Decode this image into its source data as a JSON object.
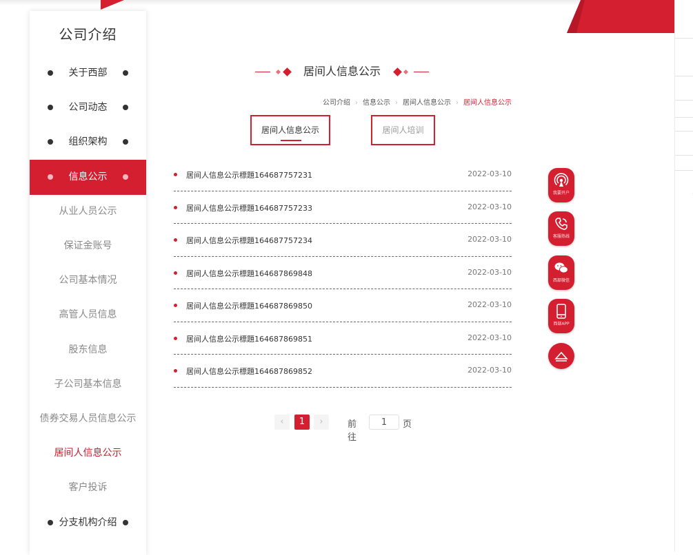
{
  "sidebar": {
    "title": "公司介绍",
    "main_items": [
      {
        "label": "关于西部"
      },
      {
        "label": "公司动态"
      },
      {
        "label": "组织架构"
      },
      {
        "label": "信息公示"
      }
    ],
    "sub_items": [
      {
        "label": "从业人员公示"
      },
      {
        "label": "保证金账号"
      },
      {
        "label": "公司基本情况"
      },
      {
        "label": "高管人员信息"
      },
      {
        "label": "股东信息"
      },
      {
        "label": "子公司基本信息"
      },
      {
        "label": "债券交易人员信息公示"
      },
      {
        "label": "居间人信息公示"
      },
      {
        "label": "客户投诉"
      }
    ],
    "bottom_item": {
      "label": "分支机构介绍"
    }
  },
  "heading": "居间人信息公示",
  "breadcrumb": [
    "公司介绍",
    "信息公示",
    "居间人信息公示",
    "居间人信息公示"
  ],
  "tabs": [
    {
      "label": "居间人信息公示"
    },
    {
      "label": "居间人培训"
    }
  ],
  "list": [
    {
      "title": "居间人信息公示標題164687757231",
      "date": "2022-03-10"
    },
    {
      "title": "居间人信息公示標題164687757233",
      "date": "2022-03-10"
    },
    {
      "title": "居间人信息公示標題164687757234",
      "date": "2022-03-10"
    },
    {
      "title": "居间人信息公示標題164687869848",
      "date": "2022-03-10"
    },
    {
      "title": "居间人信息公示標題164687869850",
      "date": "2022-03-10"
    },
    {
      "title": "居间人信息公示標題164687869851",
      "date": "2022-03-10"
    },
    {
      "title": "居间人信息公示標題164687869852",
      "date": "2022-03-10"
    }
  ],
  "pagination": {
    "prev": "‹",
    "current_page": "1",
    "next": "›",
    "goto_label": "前往",
    "goto_value": "1",
    "page_unit": "页"
  },
  "float_bar": [
    {
      "caption": "我要开户",
      "icon": "signal-icon"
    },
    {
      "caption": "客服热线",
      "icon": "phone-icon"
    },
    {
      "caption": "西部微信",
      "icon": "wechat-icon"
    },
    {
      "caption": "西部APP",
      "icon": "mobile-icon"
    },
    {
      "icon": "back-to-top-icon"
    }
  ],
  "colors": {
    "accent": "#d41f31",
    "text": "#333333",
    "muted": "#888888"
  }
}
